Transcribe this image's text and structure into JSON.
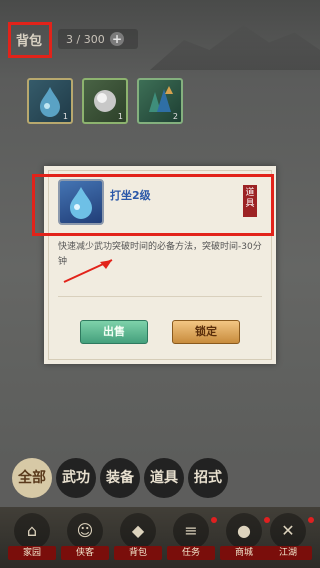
{
  "header": {
    "title": "背包",
    "capacity": "3 / 300",
    "plus": "+"
  },
  "inventory": [
    {
      "icon": "water-drop-icon",
      "qty": "1"
    },
    {
      "icon": "silver-orb-icon",
      "qty": "1"
    },
    {
      "icon": "crystal-cluster-icon",
      "qty": "2"
    }
  ],
  "dialog": {
    "item_name": "打坐2级",
    "tag": "道具",
    "description": "快速减少武功突破时间的必备方法，突破时间-30分钟",
    "sell": "出售",
    "lock": "锁定"
  },
  "categories": [
    {
      "label": "全部",
      "selected": true
    },
    {
      "label": "武功"
    },
    {
      "label": "装备"
    },
    {
      "label": "道具"
    },
    {
      "label": "招式"
    }
  ],
  "nav": [
    {
      "label": "家园",
      "icon": "house-icon"
    },
    {
      "label": "侠客",
      "icon": "warrior-icon"
    },
    {
      "label": "背包",
      "icon": "bag-icon"
    },
    {
      "label": "任务",
      "icon": "scroll-icon"
    },
    {
      "label": "商城",
      "icon": "coins-icon"
    },
    {
      "label": "江湖",
      "icon": "swords-icon"
    }
  ],
  "colors": {
    "highlight": "#e2231a",
    "item_name": "#2b58a8",
    "tag": "#9c2224"
  }
}
